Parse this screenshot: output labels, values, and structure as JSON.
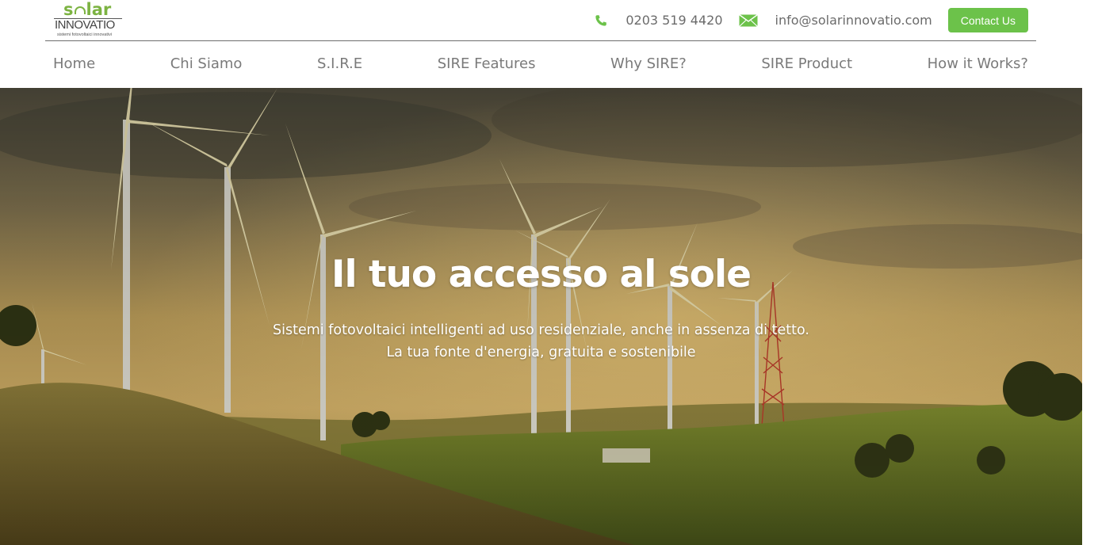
{
  "logo": {
    "word1": "s lar",
    "word2": "INNOVATIO",
    "tagline": "sistemi fotovoltaici innovativi"
  },
  "contact": {
    "phone": "0203 519 4420",
    "email": "info@solarinnovatio.com",
    "button_label": "Contact Us",
    "phone_icon": "phone-icon",
    "email_icon": "envelope-icon"
  },
  "nav": {
    "items": [
      {
        "label": "Home"
      },
      {
        "label": "Chi Siamo"
      },
      {
        "label": "S.I.R.E"
      },
      {
        "label": "SIRE Features"
      },
      {
        "label": "Why SIRE?"
      },
      {
        "label": "SIRE Product"
      },
      {
        "label": "How it Works?"
      }
    ]
  },
  "hero": {
    "title": "Il tuo accesso al sole",
    "subtitle_line1": "Sistemi fotovoltaici intelligenti ad uso residenziale, anche in assenza di tetto.",
    "subtitle_line2": "La tua fonte d'energia, gratuita e sostenibile"
  },
  "colors": {
    "accent_green": "#6cc24a",
    "nav_text": "#7a7a7a"
  }
}
